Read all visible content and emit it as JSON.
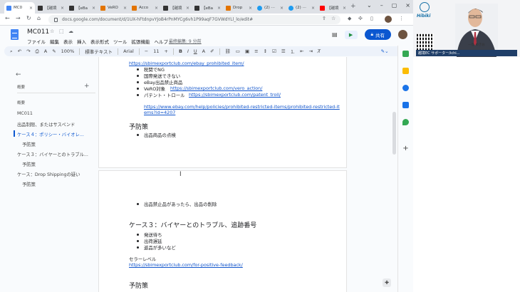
{
  "browser": {
    "tabs": [
      {
        "label": "MC0",
        "color": "#4285f4",
        "active": true
      },
      {
        "label": "【越境",
        "color": "#333333"
      },
      {
        "label": "【eBa",
        "color": "#333333"
      },
      {
        "label": "VeRO",
        "color": "#e37400"
      },
      {
        "label": "Acco",
        "color": "#e37400"
      },
      {
        "label": "【越境",
        "color": "#333333"
      },
      {
        "label": "【eBa",
        "color": "#333333"
      },
      {
        "label": "Drop",
        "color": "#e37400"
      },
      {
        "label": "(2) ⋯",
        "color": "#1d9bf0"
      },
      {
        "label": "(2) ⋯",
        "color": "#1d9bf0"
      },
      {
        "label": "【越境",
        "color": "#ff0000"
      }
    ],
    "url": "docs.google.com/document/d/1UX-hFtdnpvYJoB4rPnMYCg6vh1P99aqF7GVWdYLl_lo/edit#"
  },
  "doc": {
    "title": "MC011",
    "menu": [
      "ファイル",
      "編集",
      "表示",
      "挿入",
      "表示形式",
      "ツール",
      "拡張機能",
      "ヘルプ"
    ],
    "last_edit": "最終編集: 9 分前",
    "share_label": "共有"
  },
  "toolbar": {
    "zoom": "100%",
    "style": "標準テキスト",
    "font": "Arial",
    "font_size": "11"
  },
  "sidebar": {
    "summary_label": "概要",
    "outline_label": "概要",
    "items": [
      "MC011",
      "出品制限、またはサスペンド",
      "ケース４：ポリシー・バイオレ...",
      "予防策",
      "ケース３：バイヤーとのトラブル...",
      "予防策",
      "ケース：Drop Shippingの疑い",
      "予防策"
    ]
  },
  "page1": {
    "top_link": "https://sbimexportclub.com/ebay_prohibited_item/",
    "bullets": [
      "税関でNG",
      "国際発送できない",
      "eBay出品禁止商品"
    ],
    "vero_label": "VeRO対象",
    "vero_link": "https://sbimexportclub.com/vero_action/",
    "patent_label": "パテント・トロール",
    "patent_link": "https://sbimexportclub.com/patent_troll/",
    "long_link_1": "https://www.ebay.com/help/policies/prohibited-restricted-items/prohibited-restricted-it",
    "long_link_2": "ems?id=4207",
    "heading": "予防策",
    "prev_bullet": "出品商品の点検"
  },
  "page2": {
    "bullet_top": "出品禁止品があったら、出品の削除",
    "case_heading": "ケース３：バイヤーとのトラブル、追跡番号",
    "bullets": [
      "発送待ち",
      "出荷遅延",
      "返品が多いなど"
    ],
    "seller_level": "セラーレベル",
    "seller_link": "https://sbimexportclub.com/for-positive-feedback/",
    "heading": "予防策"
  },
  "video": {
    "brand": "Hibiki",
    "caption": "越境EC サポーター/ichi...",
    "name": "一島 ゆきお"
  },
  "colors": {
    "accent": "#0b57d0",
    "link": "#1155cc",
    "docs_blue": "#4285f4"
  }
}
